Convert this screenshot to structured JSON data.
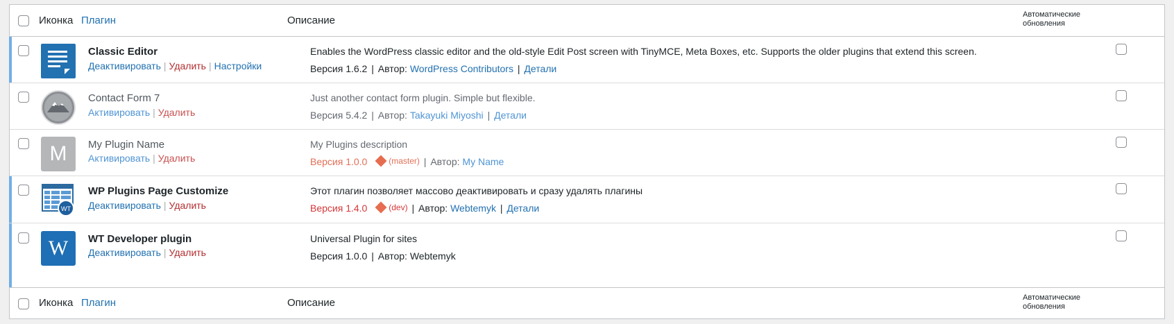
{
  "header": {
    "icon_label": "Иконка",
    "plugin_label": "Плагин",
    "desc_label": "Описание",
    "auto_updates": "Автоматические обновления"
  },
  "footer": {
    "icon_label": "Иконка",
    "plugin_label": "Плагин",
    "desc_label": "Описание",
    "auto_updates": "Автоматические обновления"
  },
  "sep": "|",
  "plugins": [
    {
      "name": "Classic Editor",
      "status": "active",
      "actions": [
        "Деактивировать",
        "Удалить",
        "Настройки"
      ],
      "description": "Enables the WordPress classic editor and the old-style Edit Post screen with TinyMCE, Meta Boxes, etc. Supports the older plugins that extend this screen.",
      "version": "Версия 1.6.2",
      "author_label": "Автор:",
      "author": "WordPress Contributors",
      "details": "Детали",
      "icon": "classic-editor-icon"
    },
    {
      "name": "Contact Form 7",
      "status": "inactive",
      "actions": [
        "Активировать",
        "Удалить"
      ],
      "description": "Just another contact form plugin. Simple but flexible.",
      "version": "Версия 5.4.2",
      "author_label": "Автор:",
      "author": "Takayuki Miyoshi",
      "details": "Детали",
      "icon": "mountain-icon"
    },
    {
      "name": "My Plugin Name",
      "status": "inactive",
      "actions": [
        "Активировать",
        "Удалить"
      ],
      "description": "My Plugins description",
      "version": "Версия 1.0.0",
      "branch": "(master)",
      "author_label": "Автор:",
      "author": "My Name",
      "icon": "letter-m-icon",
      "icon_letter": "M"
    },
    {
      "name": "WP Plugins Page Customize",
      "status": "active",
      "actions": [
        "Деактивировать",
        "Удалить"
      ],
      "description": "Этот плагин позволяет массово деактивировать и сразу удалять плагины",
      "version": "Версия 1.4.0",
      "branch": "(dev)",
      "author_label": "Автор:",
      "author": "Webtemyk",
      "details": "Детали",
      "icon": "plugins-manager-icon",
      "icon_badge": "WT"
    },
    {
      "name": "WT Developer plugin",
      "status": "active",
      "actions": [
        "Деактивировать",
        "Удалить"
      ],
      "description": "Universal Plugin for sites",
      "version": "Версия 1.0.0",
      "author_label": "Автор:",
      "author": "Webtemyk",
      "icon": "letter-w-icon",
      "icon_letter": "W"
    }
  ],
  "colors": {
    "link": "#2271b1",
    "delete": "#b32d2e",
    "active_bar": "#72aee6",
    "branch": "#e66d4f"
  }
}
